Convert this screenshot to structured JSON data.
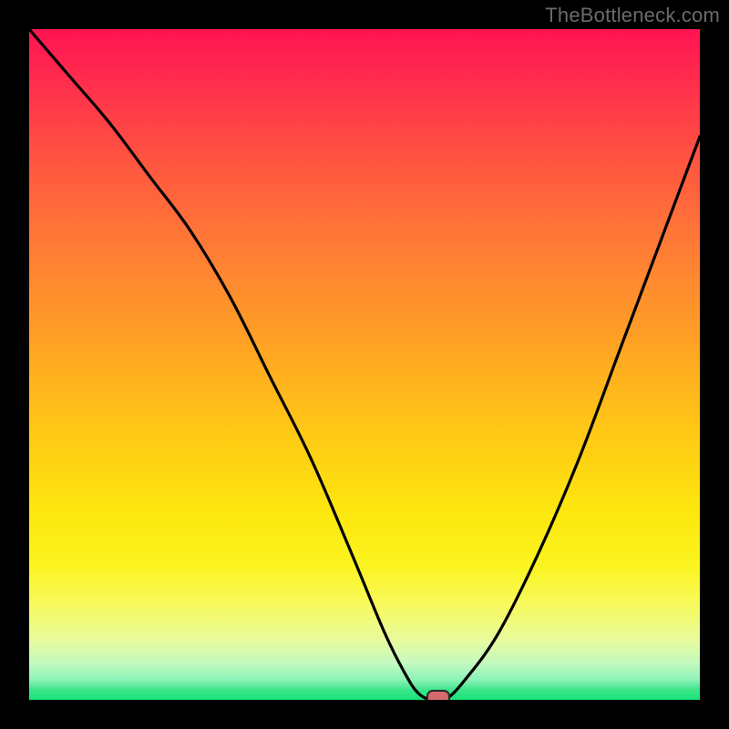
{
  "watermark": "TheBottleneck.com",
  "colors": {
    "frame": "#000000",
    "curve": "#000000",
    "marker_fill": "#d66a6c",
    "marker_border": "#2a2a2a",
    "watermark_text": "#6a6a6a"
  },
  "chart_data": {
    "type": "line",
    "title": "",
    "xlabel": "",
    "ylabel": "",
    "xlim": [
      0,
      100
    ],
    "ylim": [
      0,
      100
    ],
    "grid": false,
    "legend": false,
    "series": [
      {
        "name": "bottleneck-curve",
        "x": [
          0,
          6,
          12,
          18,
          24,
          30,
          36,
          42,
          48,
          53,
          56,
          58,
          60,
          62,
          65,
          70,
          76,
          82,
          88,
          94,
          100
        ],
        "values": [
          100,
          93,
          86,
          78,
          70,
          60,
          48,
          36,
          22,
          10,
          4,
          1,
          0,
          0,
          3,
          10,
          22,
          36,
          52,
          68,
          84
        ]
      }
    ],
    "marker": {
      "x": 61,
      "y": 0,
      "shape": "pill"
    },
    "background_gradient": {
      "orientation": "vertical",
      "stops": [
        {
          "pos": 0.0,
          "color": "#ff1352"
        },
        {
          "pos": 0.2,
          "color": "#ff5640"
        },
        {
          "pos": 0.46,
          "color": "#ffa025"
        },
        {
          "pos": 0.72,
          "color": "#fde70e"
        },
        {
          "pos": 0.86,
          "color": "#f7fa5f"
        },
        {
          "pos": 0.95,
          "color": "#c4fac0"
        },
        {
          "pos": 1.0,
          "color": "#18e37a"
        }
      ]
    }
  }
}
